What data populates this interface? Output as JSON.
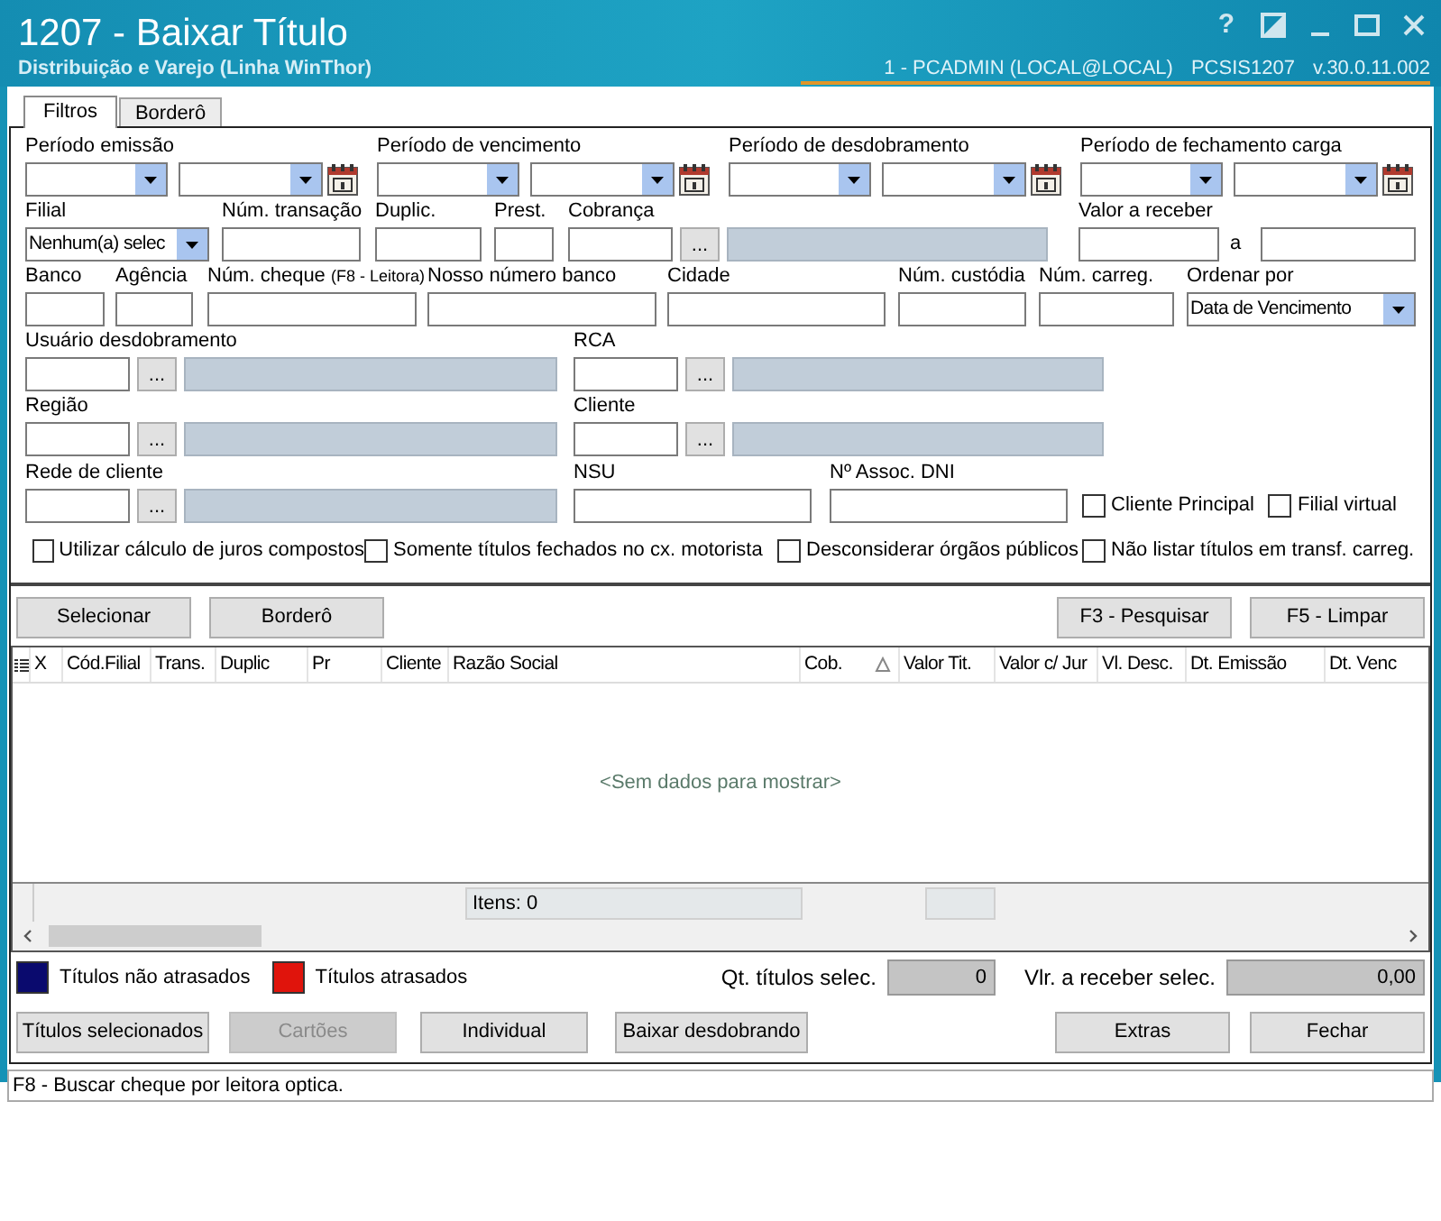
{
  "window": {
    "title": "1207 - Baixar Título",
    "subtitle": "Distribuição e Varejo (Linha WinThor)",
    "user_info": "1 - PCADMIN (LOCAL@LOCAL)",
    "program": "PCSIS1207",
    "version": "v.30.0.11.002",
    "help_label": "?"
  },
  "tabs": [
    {
      "label": "Filtros",
      "selected": true
    },
    {
      "label": "Borderô",
      "selected": false
    }
  ],
  "filter_rows": [
    [
      {
        "kind": "date_range",
        "label": "Período emissão"
      },
      {
        "kind": "date_range",
        "label": "Período de vencimento"
      },
      {
        "kind": "date_range",
        "label": "Período de desdobramento"
      },
      {
        "kind": "date_range",
        "label": "Período de fechamento carga"
      }
    ],
    [
      {
        "kind": "combo",
        "label": "Filial",
        "value": "Nenhum(a) selec"
      },
      {
        "kind": "text",
        "label": "Núm. transação"
      },
      {
        "kind": "text",
        "label": "Duplic."
      },
      {
        "kind": "text",
        "label": "Prest."
      },
      {
        "kind": "lookup",
        "label": "Cobrança",
        "button_label": "..."
      },
      {
        "kind": "text",
        "label": "Valor a receber"
      },
      {
        "kind": "caption",
        "label": "a"
      },
      {
        "kind": "text"
      }
    ],
    [
      {
        "kind": "text",
        "label": "Banco"
      },
      {
        "kind": "text",
        "label": "Agência"
      },
      {
        "kind": "text",
        "label": "Núm. cheque",
        "hint": "(F8 - Leitora)"
      },
      {
        "kind": "text",
        "label": "Nosso número banco"
      },
      {
        "kind": "text",
        "label": "Cidade"
      },
      {
        "kind": "text",
        "label": "Núm. custódia"
      },
      {
        "kind": "text",
        "label": "Núm. carreg."
      },
      {
        "kind": "combo",
        "label": "Ordenar por",
        "value": "Data de Vencimento"
      }
    ],
    [
      {
        "kind": "lookup",
        "label": "Usuário desdobramento",
        "button_label": "..."
      },
      {
        "kind": "lookup",
        "label": "RCA",
        "button_label": "..."
      }
    ],
    [
      {
        "kind": "lookup",
        "label": "Região",
        "button_label": "..."
      },
      {
        "kind": "lookup",
        "label": "Cliente",
        "button_label": "..."
      }
    ],
    [
      {
        "kind": "lookup",
        "label": "Rede de cliente",
        "button_label": "..."
      },
      {
        "kind": "text",
        "label": "NSU"
      },
      {
        "kind": "text",
        "label": "Nº Assoc. DNI"
      },
      {
        "kind": "checkbox",
        "label": "Cliente Principal",
        "checked": false
      },
      {
        "kind": "checkbox",
        "label": "Filial virtual",
        "checked": false
      }
    ],
    [
      {
        "kind": "checkbox",
        "label": "Utilizar cálculo de juros compostos",
        "checked": false
      },
      {
        "kind": "checkbox",
        "label": "Somente títulos fechados no cx. motorista",
        "checked": false
      },
      {
        "kind": "checkbox",
        "label": "Desconsiderar órgãos públicos",
        "checked": false
      },
      {
        "kind": "checkbox",
        "label": "Não listar títulos em transf. carreg.",
        "checked": false
      }
    ]
  ],
  "action_buttons": [
    {
      "label": "Selecionar"
    },
    {
      "label": "Borderô"
    },
    {
      "label": "F3 - Pesquisar"
    },
    {
      "label": "F5 - Limpar"
    }
  ],
  "table": {
    "columns": [
      {
        "label": "X",
        "sorted": false
      },
      {
        "label": "Cód.Filial",
        "sorted": false
      },
      {
        "label": "Trans.",
        "sorted": false
      },
      {
        "label": "Duplic",
        "sorted": false
      },
      {
        "label": "Pr",
        "sorted": false
      },
      {
        "label": "Cliente",
        "sorted": false
      },
      {
        "label": "Razão Social",
        "sorted": false
      },
      {
        "label": "Cob.",
        "sorted": true
      },
      {
        "label": "Valor Tit.",
        "sorted": false
      },
      {
        "label": "Valor c/ Jur",
        "sorted": false
      },
      {
        "label": "Vl. Desc.",
        "sorted": false
      },
      {
        "label": "Dt. Emissão",
        "sorted": false
      },
      {
        "label": "Dt. Venc",
        "sorted": false
      }
    ],
    "empty_text": "<Sem dados para mostrar>",
    "footer": "Itens: 0"
  },
  "legend": [
    {
      "label": "Títulos não atrasados",
      "color": "#0a0a6e"
    },
    {
      "label": "Títulos atrasados",
      "color": "#e0140c"
    }
  ],
  "totals": [
    {
      "label": "Qt. títulos selec.",
      "value": "0"
    },
    {
      "label": "Vlr. a receber selec.",
      "value": "0,00"
    }
  ],
  "bottom_buttons": [
    {
      "label": "Títulos selecionados",
      "disabled": false
    },
    {
      "label": "Cartões",
      "disabled": true
    },
    {
      "label": "Individual",
      "disabled": false
    },
    {
      "label": "Baixar desdobrando",
      "disabled": false
    },
    {
      "label": "Extras",
      "disabled": false
    },
    {
      "label": "Fechar",
      "disabled": false
    }
  ],
  "status_bar": "F8 - Buscar cheque por leitora optica."
}
